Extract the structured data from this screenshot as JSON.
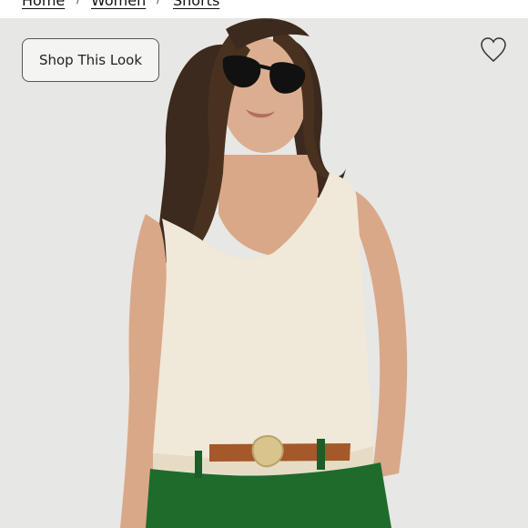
{
  "breadcrumb": {
    "items": [
      "Home",
      "Women",
      "Shorts"
    ],
    "separator": "/"
  },
  "product_image": {
    "alt": "Woman wearing cream knit V-neck sweater tank, sunglasses, cognac belt and green shorts",
    "background_color": "#e7e7e5",
    "colors": {
      "top": "#f0e8d8",
      "shorts": "#1f6b2c",
      "belt": "#a5582a",
      "buckle": "#d9c48c",
      "hair": "#3d2a1e",
      "skin": "#d9a888"
    }
  },
  "shop_button": {
    "label": "Shop This Look"
  },
  "favorite": {
    "icon": "heart-outline-icon"
  }
}
